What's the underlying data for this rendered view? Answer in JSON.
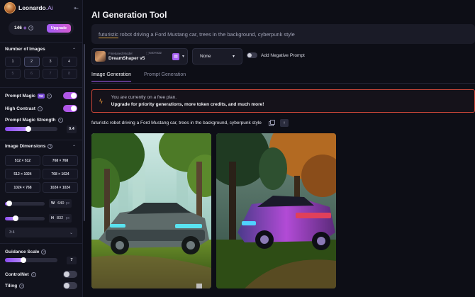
{
  "sidebar": {
    "logo": "Leonardo",
    "logo_suffix": ".Ai",
    "tokens": "146",
    "upgrade": "Upgrade",
    "num_images": {
      "label": "Number of Images",
      "options": [
        "1",
        "2",
        "3",
        "4",
        "5",
        "6",
        "7",
        "8"
      ],
      "selected": "2"
    },
    "prompt_magic": {
      "label": "Prompt Magic",
      "badge": "V2",
      "on": true
    },
    "high_contrast": {
      "label": "High Contrast",
      "on": true
    },
    "prompt_magic_strength": {
      "label": "Prompt Magic Strength",
      "value": "0.4",
      "fraction": 0.45
    },
    "image_dimensions": {
      "label": "Image Dimensions",
      "options": [
        "512 × 512",
        "768 × 768",
        "512 × 1024",
        "768 × 1024",
        "1024 × 768",
        "1024 × 1024"
      ],
      "width": {
        "label": "W",
        "value": "640",
        "unit": "px",
        "fraction": 0.1
      },
      "height": {
        "label": "H",
        "value": "832",
        "unit": "px",
        "fraction": 0.27
      }
    },
    "aspect_ratio": "3:4",
    "guidance_scale": {
      "label": "Guidance Scale",
      "value": "7",
      "fraction": 0.35
    },
    "controlnet": {
      "label": "ControlNet",
      "on": false
    },
    "tiling": {
      "label": "Tiling",
      "on": false
    }
  },
  "main": {
    "title": "AI Generation Tool",
    "prompt_hl": "futuristic",
    "prompt_rest": " robot driving a Ford Mustang car, trees in the background, cyberpunk style",
    "model": {
      "caption": "Finetuned Model",
      "dimensions": "640×832",
      "name": "DreamShaper v5"
    },
    "style": "None",
    "negative_prompt": "Add Negative Prompt",
    "tabs": [
      "Image Generation",
      "Prompt Generation"
    ],
    "banner": {
      "line1": "You are currently on a free plan.",
      "line2": "Upgrade for priority generations, more token credits, and much more!"
    },
    "generation_prompt": "futuristic robot driving a Ford Mustang car, trees in the background, cyberpunk style"
  },
  "colors": {
    "accent": "#a45ef2",
    "banner_border": "#d0483a",
    "background": "#0d0e16"
  }
}
